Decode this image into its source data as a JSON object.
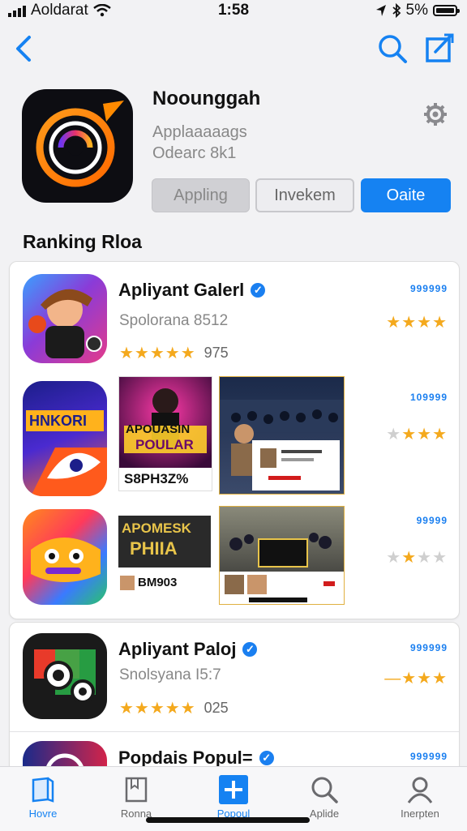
{
  "status": {
    "carrier": "Aoldarat",
    "time": "1:58",
    "battery": "5%"
  },
  "app": {
    "title": "Noounggah",
    "subtitle1": "Applaaaaags",
    "subtitle2": "Odearc 8k1",
    "buttons": [
      "Appling",
      "Invekem",
      "Oaite"
    ]
  },
  "section_title": "Ranking Rloa",
  "rows": [
    {
      "title": "Apliyant Galerl",
      "sub": "Spolorana 8512",
      "rating": "975",
      "rank": "999999",
      "stars": 4
    },
    {
      "rank": "109999",
      "stars": 3,
      "shot1_title": "APOUASIN",
      "shot1_title2": "POULAR",
      "shot1_label": "S8PH3Z%"
    },
    {
      "rank": "99999",
      "stars": 2,
      "shot1_title": "APOMESK",
      "shot1_title2": "PHIIA",
      "shot1_label": "BM903"
    },
    {
      "title": "Apliyant Paloj",
      "sub": "Snolsyana I5:7",
      "rating": "025",
      "rank": "999999",
      "stars": 3
    },
    {
      "title": "Popdais Popul=",
      "rank": "999999"
    }
  ],
  "tabs": [
    {
      "label": "Hovre",
      "icon": "book-icon"
    },
    {
      "label": "Ronna",
      "icon": "bookmark-icon"
    },
    {
      "label": "Popoul",
      "icon": "plus-icon"
    },
    {
      "label": "Aplide",
      "icon": "search-icon"
    },
    {
      "label": "Inerpten",
      "icon": "person-icon"
    }
  ],
  "colors": {
    "accent": "#1582f2",
    "star": "#f4a91d",
    "background": "#f2f2f4"
  }
}
